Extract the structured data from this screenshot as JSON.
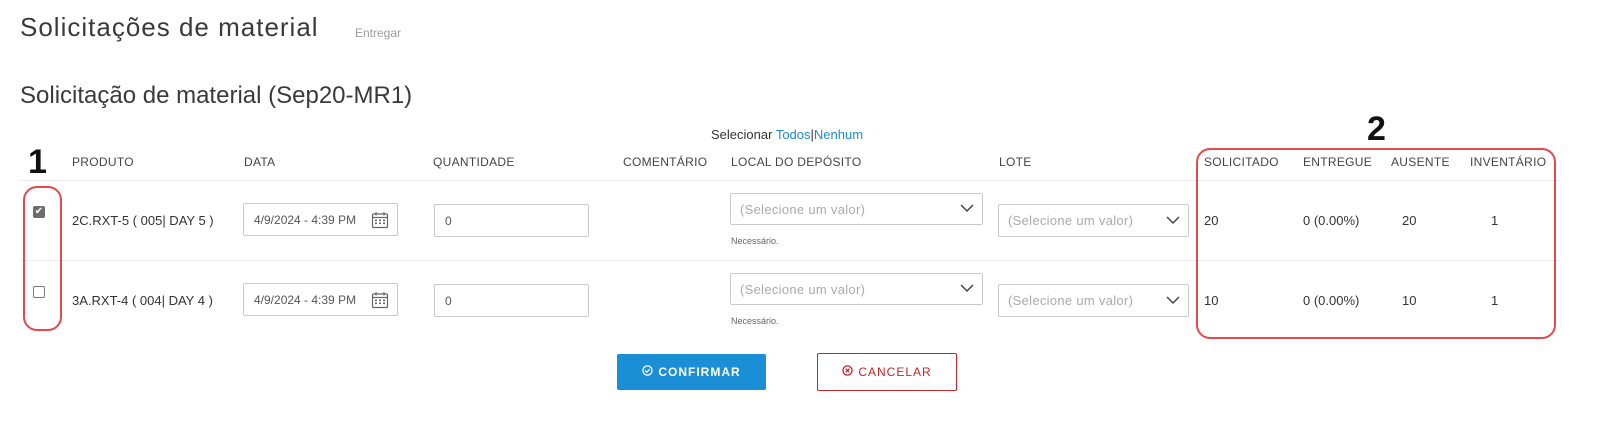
{
  "header": {
    "title": "Solicitações de material",
    "subtitle": "Entregar"
  },
  "section": {
    "title": "Solicitação de material (Sep20-MR1)"
  },
  "selection": {
    "label": "Selecionar",
    "all": "Todos",
    "separator": "|",
    "none": "Nenhum"
  },
  "columns": {
    "produto": "PRODUTO",
    "data": "DATA",
    "quantidade": "QUANTIDADE",
    "comentario": "COMENTÁRIO",
    "local": "LOCAL DO DEPÓSITO",
    "lote": "LOTE",
    "solicitado": "SOLICITADO",
    "entregue": "ENTREGUE",
    "ausente": "AUSENTE",
    "inventario": "INVENTÁRIO"
  },
  "rows": [
    {
      "checked": true,
      "produto": "2C.RXT-5 ( 005| DAY 5 )",
      "data": "4/9/2024 - 4:39 PM",
      "quantidade": "0",
      "local_placeholder": "(Selecione um valor)",
      "local_note": "Necessário.",
      "lote_placeholder": "(Selecione um valor)",
      "solicitado": "20",
      "entregue": "0 (0.00%)",
      "ausente": "20",
      "inventario": "1"
    },
    {
      "checked": false,
      "produto": "3A.RXT-4 ( 004| DAY 4 )",
      "data": "4/9/2024 - 4:39 PM",
      "quantidade": "0",
      "local_placeholder": "(Selecione um valor)",
      "local_note": "Necessário.",
      "lote_placeholder": "(Selecione um valor)",
      "solicitado": "10",
      "entregue": "0 (0.00%)",
      "ausente": "10",
      "inventario": "1"
    }
  ],
  "buttons": {
    "confirm": "CONFIRMAR",
    "cancel": "CANCELAR"
  },
  "annotations": {
    "label_1": "1",
    "label_2": "2"
  },
  "icons": {
    "confirm": "circle-check-icon",
    "cancel": "circle-x-icon",
    "calendar": "calendar-icon",
    "dropdown": "chevron-down-icon",
    "checkbox_mark": "✔"
  },
  "colors": {
    "accent": "#1b8fd6",
    "link": "#1b8bd0",
    "cancel": "#c4242b",
    "annotation": "#e8474c"
  }
}
